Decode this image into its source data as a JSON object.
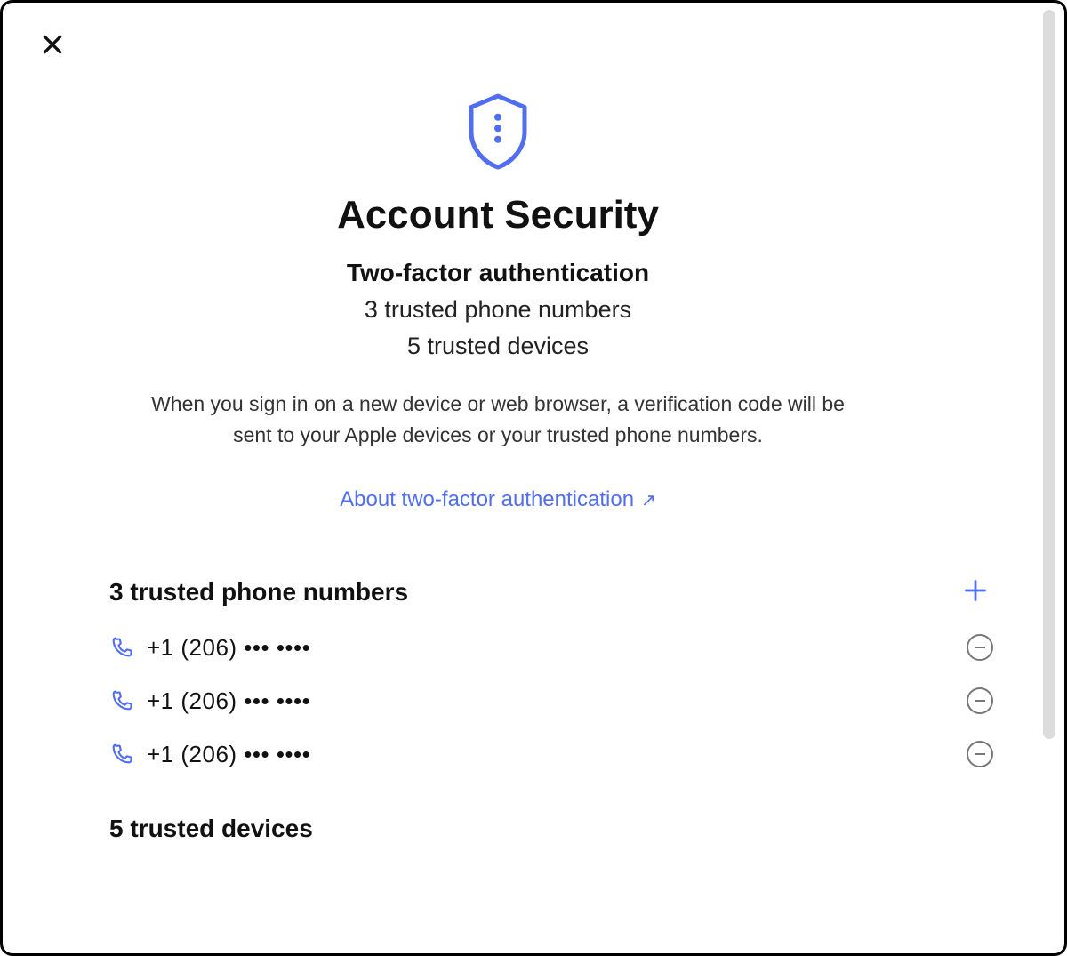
{
  "header": {
    "title": "Account Security",
    "subtitle": "Two-factor authentication",
    "trusted_phones_summary": "3 trusted phone numbers",
    "trusted_devices_summary": "5 trusted devices",
    "description": "When you sign in on a new device or web browser, a verification code will be sent to your Apple devices or your trusted phone numbers.",
    "learn_more_label": "About two-factor authentication"
  },
  "phones_section": {
    "title": "3 trusted phone numbers",
    "add_label": "+",
    "items": [
      {
        "number": "+1 (206) ••• ••••"
      },
      {
        "number": "+1 (206) ••• ••••"
      },
      {
        "number": "+1 (206) ••• ••••"
      }
    ]
  },
  "devices_section": {
    "title": "5 trusted devices"
  },
  "icons": {
    "close": "close-icon",
    "shield": "shield-icon",
    "external_link": "external-link-icon",
    "phone": "phone-icon",
    "add": "plus-icon",
    "remove": "minus-circle-icon"
  },
  "colors": {
    "accent": "#4f6ef2"
  }
}
